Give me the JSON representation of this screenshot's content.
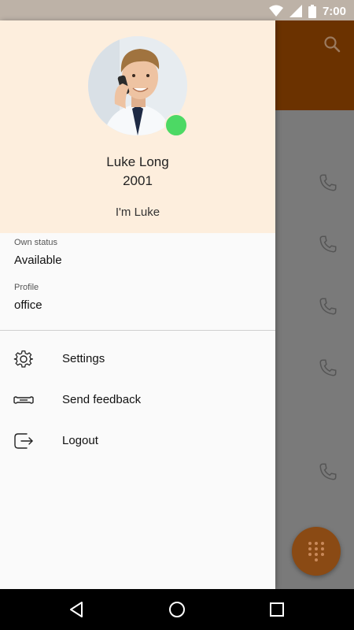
{
  "status_bar": {
    "time": "7:00",
    "icons": [
      "wifi-icon",
      "signal-icon",
      "battery-icon"
    ]
  },
  "app": {
    "toolbar_color": "#6b3200",
    "icons": [
      "search-icon",
      "phone-icon",
      "dialpad-icon"
    ]
  },
  "drawer": {
    "user": {
      "name": "Luke Long",
      "extension": "2001",
      "status_message": "I'm Luke"
    },
    "own_status": {
      "label": "Own status",
      "value": "Available"
    },
    "profile": {
      "label": "Profile",
      "value": "office"
    },
    "menu": [
      {
        "icon": "gear-icon",
        "label": "Settings"
      },
      {
        "icon": "feedback-icon",
        "label": "Send feedback"
      },
      {
        "icon": "logout-icon",
        "label": "Logout"
      }
    ],
    "presence_color": "#4cd964",
    "header_color": "#fdeedd"
  },
  "nav_bar": {
    "buttons": [
      "back-icon",
      "home-icon",
      "recents-icon"
    ]
  }
}
